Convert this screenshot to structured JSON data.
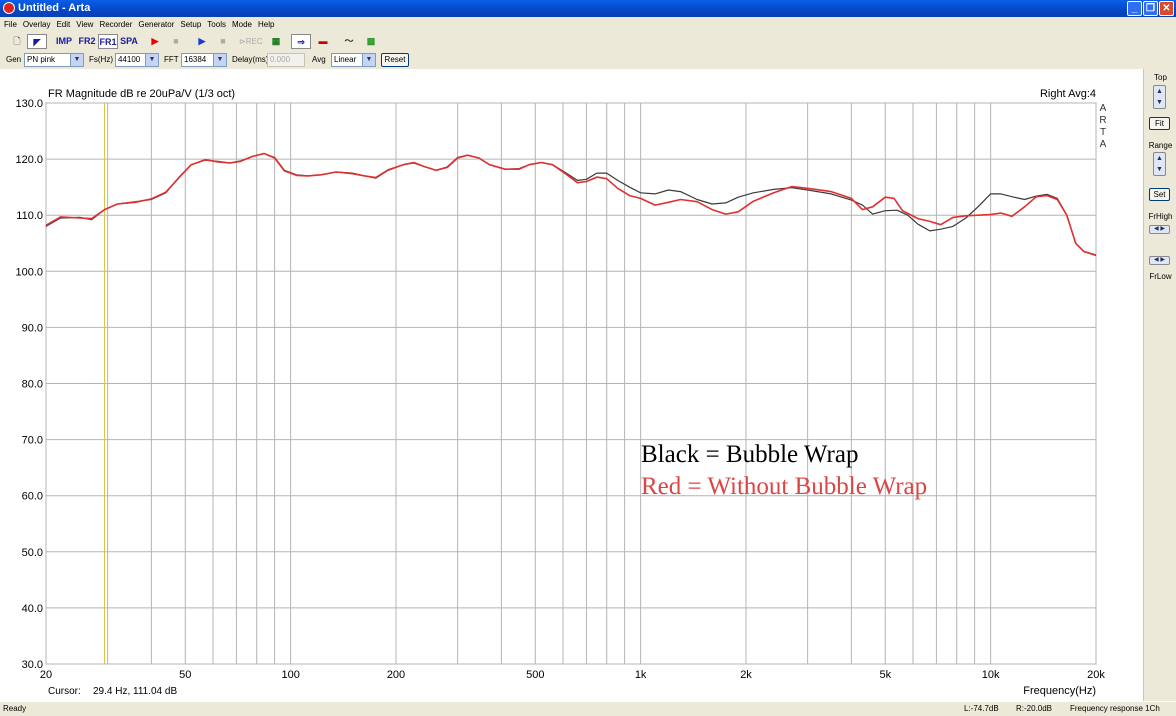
{
  "window": {
    "title": "Untitled - Arta"
  },
  "menu": [
    "File",
    "Overlay",
    "Edit",
    "View",
    "Recorder",
    "Generator",
    "Setup",
    "Tools",
    "Mode",
    "Help"
  ],
  "toolbar": {
    "imp": "IMP",
    "fr2": "FR2",
    "fr1": "FR1",
    "spa": "SPA"
  },
  "gen_bar": {
    "gen_label": "Gen",
    "gen_value": "PN pink",
    "fs_label": "Fs(Hz)",
    "fs_value": "44100",
    "fft_label": "FFT",
    "fft_value": "16384",
    "delay_label": "Delay(ms)",
    "delay_value": "0.000",
    "avg_label": "Avg",
    "avg_value": "Linear",
    "reset_label": "Reset"
  },
  "right_panel": {
    "top": "Top",
    "fit": "Fit",
    "range": "Range",
    "set": "Set",
    "frhigh": "FrHigh",
    "frlow": "FrLow"
  },
  "plot": {
    "header_left": "FR Magnitude dB re 20uPa/V (1/3 oct)",
    "header_right": "Right  Avg:4",
    "arta_mark": "ARTA",
    "cursor_label": "Cursor:",
    "cursor_value": "29.4 Hz, 111.04 dB",
    "annotation_black": "Black = Bubble Wrap",
    "annotation_red": "Red = Without Bubble Wrap"
  },
  "status": {
    "ready": "Ready",
    "left_level": "L:-74.7dB",
    "right_level": "R:-20.0dB",
    "mode": "Frequency response 1Ch"
  },
  "chart_data": {
    "type": "line",
    "xscale": "log",
    "xlabel": "Frequency(Hz)",
    "ylabel": "",
    "xlim": [
      20,
      20000
    ],
    "ylim": [
      30,
      130
    ],
    "x_ticks": [
      20,
      50,
      100,
      200,
      500,
      1000,
      2000,
      5000,
      10000,
      20000
    ],
    "x_tick_labels": [
      "20",
      "50",
      "100",
      "200",
      "500",
      "1k",
      "2k",
      "5k",
      "10k",
      "20k"
    ],
    "y_ticks": [
      30,
      40,
      50,
      60,
      70,
      80,
      90,
      100,
      110,
      120,
      130
    ],
    "y_tick_labels": [
      "30.0",
      "40.0",
      "50.0",
      "60.0",
      "70.0",
      "80.0",
      "90.0",
      "100.0",
      "110.0",
      "120.0",
      "130.0"
    ],
    "cursor_x": 29.4,
    "series": [
      {
        "color": "#3a3a3a",
        "points": [
          [
            20,
            108.0
          ],
          [
            22,
            109.5
          ],
          [
            25,
            109.6
          ],
          [
            27,
            109.2
          ],
          [
            29.4,
            111.0
          ],
          [
            32,
            112.0
          ],
          [
            36,
            112.4
          ],
          [
            40,
            112.8
          ],
          [
            44,
            114.0
          ],
          [
            48,
            116.8
          ],
          [
            52,
            119.0
          ],
          [
            57,
            119.8
          ],
          [
            62,
            119.6
          ],
          [
            67,
            119.3
          ],
          [
            72,
            119.7
          ],
          [
            78,
            120.5
          ],
          [
            84,
            121.0
          ],
          [
            90,
            120.3
          ],
          [
            96,
            118.0
          ],
          [
            104,
            117.2
          ],
          [
            112,
            117.0
          ],
          [
            122,
            117.2
          ],
          [
            135,
            117.7
          ],
          [
            150,
            117.5
          ],
          [
            163,
            117.0
          ],
          [
            175,
            116.6
          ],
          [
            190,
            118.0
          ],
          [
            210,
            119.0
          ],
          [
            225,
            119.3
          ],
          [
            240,
            118.7
          ],
          [
            260,
            118.0
          ],
          [
            280,
            118.6
          ],
          [
            300,
            120.3
          ],
          [
            320,
            120.7
          ],
          [
            345,
            120.2
          ],
          [
            370,
            119.0
          ],
          [
            410,
            118.2
          ],
          [
            450,
            118.3
          ],
          [
            480,
            119.0
          ],
          [
            520,
            119.4
          ],
          [
            560,
            119.0
          ],
          [
            610,
            117.6
          ],
          [
            660,
            116.2
          ],
          [
            700,
            116.4
          ],
          [
            750,
            117.5
          ],
          [
            800,
            117.5
          ],
          [
            860,
            116.2
          ],
          [
            930,
            115.0
          ],
          [
            1000,
            114.0
          ],
          [
            1100,
            113.8
          ],
          [
            1200,
            114.5
          ],
          [
            1300,
            114.2
          ],
          [
            1450,
            112.8
          ],
          [
            1600,
            112.0
          ],
          [
            1750,
            112.2
          ],
          [
            1900,
            113.2
          ],
          [
            2100,
            114.0
          ],
          [
            2400,
            114.6
          ],
          [
            2700,
            114.9
          ],
          [
            3000,
            114.5
          ],
          [
            3500,
            113.8
          ],
          [
            4000,
            112.7
          ],
          [
            4300,
            111.8
          ],
          [
            4600,
            110.2
          ],
          [
            5000,
            110.8
          ],
          [
            5400,
            110.9
          ],
          [
            5800,
            110.0
          ],
          [
            6200,
            108.4
          ],
          [
            6700,
            107.2
          ],
          [
            7200,
            107.5
          ],
          [
            7800,
            108.0
          ],
          [
            8500,
            109.5
          ],
          [
            9200,
            111.5
          ],
          [
            10000,
            113.8
          ],
          [
            10700,
            113.8
          ],
          [
            11500,
            113.3
          ],
          [
            12500,
            112.8
          ],
          [
            13500,
            113.4
          ],
          [
            14500,
            113.7
          ],
          [
            15500,
            113.0
          ],
          [
            16500,
            110.0
          ],
          [
            17500,
            105.0
          ],
          [
            18500,
            103.5
          ],
          [
            20000,
            102.8
          ]
        ]
      },
      {
        "color": "#e03030",
        "points": [
          [
            20,
            108.2
          ],
          [
            22,
            109.7
          ],
          [
            25,
            109.5
          ],
          [
            27,
            109.4
          ],
          [
            29.4,
            111.0
          ],
          [
            32,
            112.0
          ],
          [
            36,
            112.3
          ],
          [
            40,
            112.9
          ],
          [
            44,
            114.1
          ],
          [
            48,
            116.7
          ],
          [
            52,
            119.0
          ],
          [
            57,
            119.9
          ],
          [
            62,
            119.5
          ],
          [
            67,
            119.3
          ],
          [
            72,
            119.6
          ],
          [
            78,
            120.5
          ],
          [
            84,
            121.0
          ],
          [
            90,
            120.2
          ],
          [
            96,
            117.9
          ],
          [
            104,
            117.1
          ],
          [
            112,
            117.0
          ],
          [
            122,
            117.2
          ],
          [
            135,
            117.7
          ],
          [
            150,
            117.4
          ],
          [
            163,
            117.0
          ],
          [
            175,
            116.7
          ],
          [
            190,
            118.1
          ],
          [
            210,
            119.0
          ],
          [
            225,
            119.4
          ],
          [
            240,
            118.7
          ],
          [
            260,
            118.0
          ],
          [
            280,
            118.5
          ],
          [
            300,
            120.2
          ],
          [
            320,
            120.7
          ],
          [
            345,
            120.2
          ],
          [
            370,
            119.0
          ],
          [
            410,
            118.2
          ],
          [
            450,
            118.2
          ],
          [
            480,
            119.0
          ],
          [
            520,
            119.4
          ],
          [
            560,
            119.0
          ],
          [
            610,
            117.4
          ],
          [
            660,
            115.8
          ],
          [
            700,
            116.0
          ],
          [
            750,
            116.8
          ],
          [
            800,
            116.5
          ],
          [
            860,
            114.8
          ],
          [
            930,
            113.5
          ],
          [
            1000,
            113.0
          ],
          [
            1100,
            111.8
          ],
          [
            1200,
            112.3
          ],
          [
            1300,
            112.8
          ],
          [
            1450,
            112.4
          ],
          [
            1600,
            111.0
          ],
          [
            1750,
            110.2
          ],
          [
            1900,
            110.6
          ],
          [
            2100,
            112.5
          ],
          [
            2400,
            114.0
          ],
          [
            2700,
            115.1
          ],
          [
            3000,
            114.8
          ],
          [
            3500,
            114.2
          ],
          [
            4000,
            113.0
          ],
          [
            4300,
            111.0
          ],
          [
            4600,
            111.5
          ],
          [
            5000,
            113.2
          ],
          [
            5300,
            113.0
          ],
          [
            5600,
            110.8
          ],
          [
            6200,
            109.4
          ],
          [
            6700,
            108.9
          ],
          [
            7200,
            108.3
          ],
          [
            7800,
            109.6
          ],
          [
            8500,
            109.9
          ],
          [
            9200,
            110.0
          ],
          [
            10000,
            110.1
          ],
          [
            10700,
            110.4
          ],
          [
            11500,
            109.8
          ],
          [
            12500,
            111.5
          ],
          [
            13500,
            113.3
          ],
          [
            14500,
            113.5
          ],
          [
            15500,
            112.8
          ],
          [
            16500,
            110.0
          ],
          [
            17500,
            105.0
          ],
          [
            18500,
            103.5
          ],
          [
            20000,
            102.9
          ]
        ]
      }
    ]
  }
}
